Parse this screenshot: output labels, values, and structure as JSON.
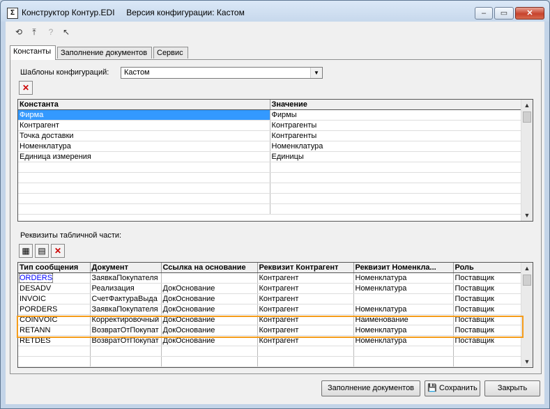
{
  "window": {
    "title": "Конструктор Контур.EDI     Версия конфигурации: Кастом",
    "icon": "edi-app-icon"
  },
  "toolbar": {
    "items": [
      {
        "name": "open-config-icon",
        "glyph": "⟲"
      },
      {
        "name": "load-config-icon",
        "glyph": "⤒"
      },
      {
        "name": "help-icon",
        "glyph": "?"
      },
      {
        "name": "pointer-help-icon",
        "glyph": "↖"
      }
    ]
  },
  "tabs": [
    "Константы",
    "Заполнение документов",
    "Сервис"
  ],
  "constants_tab": {
    "templates_label": "Шаблоны конфигураций:",
    "templates_value": "Кастом",
    "grid": {
      "headers": [
        "Константа",
        "Значение"
      ],
      "rows": [
        [
          "Фирма",
          "Фирмы"
        ],
        [
          "Контрагент",
          "Контрагенты"
        ],
        [
          "Точка доставки",
          "Контрагенты"
        ],
        [
          "Номенклатура",
          "Номенклатура"
        ],
        [
          "Единица измерения",
          "Единицы"
        ],
        [
          "",
          ""
        ],
        [
          "",
          ""
        ],
        [
          "",
          ""
        ],
        [
          "",
          ""
        ],
        [
          "",
          ""
        ]
      ]
    },
    "table_props_label": "Реквизиты табличной части:",
    "props_grid": {
      "headers": [
        "Тип сообщения",
        "Документ",
        "Ссылка на основание",
        "Реквизит Контрагент",
        "Реквизит Номенкла...",
        "Роль"
      ],
      "rows": [
        [
          "ORDERS",
          "ЗаявкаПокупателя",
          "",
          "Контрагент",
          "Номенклатура",
          "Поставщик"
        ],
        [
          "DESADV",
          "Реализация",
          "ДокОснование",
          "Контрагент",
          "Номенклатура",
          "Поставщик"
        ],
        [
          "INVOIC",
          "СчетФактураВыда",
          "ДокОснование",
          "Контрагент",
          "",
          "Поставщик"
        ],
        [
          "PORDERS",
          "ЗаявкаПокупателя",
          "ДокОснование",
          "Контрагент",
          "Номенклатура",
          "Поставщик"
        ],
        [
          "COINVOIC",
          "Корректировочный",
          "ДокОснование",
          "Контрагент",
          "Наименование",
          "Поставщик"
        ],
        [
          "RETANN",
          "ВозвратОтПокупат",
          "ДокОснование",
          "Контрагент",
          "Номенклатура",
          "Поставщик"
        ],
        [
          "RETDES",
          "ВозвратОтПокупат",
          "ДокОснование",
          "Контрагент",
          "Номенклатура",
          "Поставщик"
        ],
        [
          "",
          "",
          "",
          "",
          "",
          ""
        ],
        [
          "",
          "",
          "",
          "",
          "",
          ""
        ],
        [
          "",
          "",
          "",
          "",
          "",
          ""
        ]
      ]
    }
  },
  "buttons": {
    "fill_docs": "Заполнение документов",
    "save": "Сохранить",
    "close": "Закрыть"
  },
  "colors": {
    "selection": "#3399ff",
    "highlight": "#f59c1a"
  }
}
